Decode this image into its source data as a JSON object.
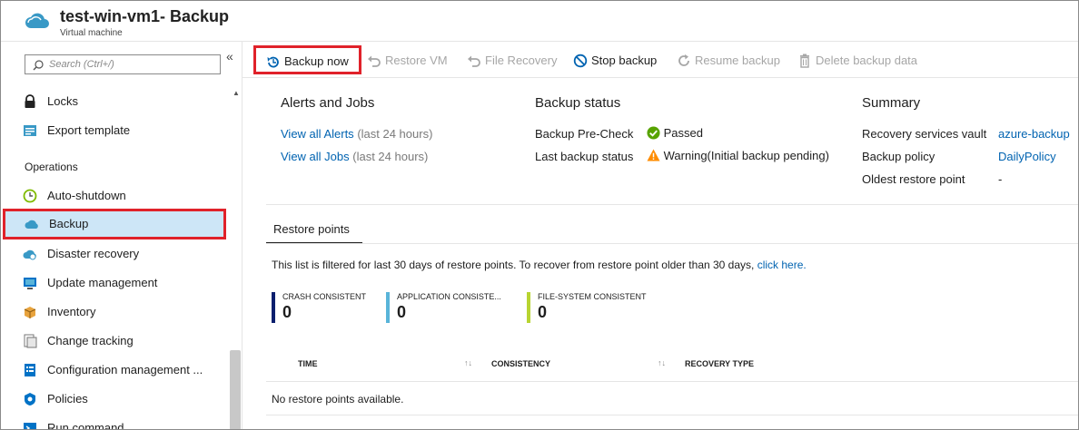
{
  "header": {
    "title": "test-win-vm1- Backup",
    "subtitle": "Virtual machine"
  },
  "sidebar": {
    "search_placeholder": "Search (Ctrl+/)",
    "collapse_glyph": "«",
    "items": [
      {
        "label": "Locks",
        "icon": "lock-icon"
      },
      {
        "label": "Export template",
        "icon": "export-template-icon"
      },
      {
        "label": "Auto-shutdown",
        "icon": "clock-icon"
      },
      {
        "label": "Backup",
        "icon": "backup-cloud-icon",
        "active": true
      },
      {
        "label": "Disaster recovery",
        "icon": "disaster-recovery-icon"
      },
      {
        "label": "Update management",
        "icon": "update-management-icon"
      },
      {
        "label": "Inventory",
        "icon": "inventory-icon"
      },
      {
        "label": "Change tracking",
        "icon": "change-tracking-icon"
      },
      {
        "label": "Configuration management ...",
        "icon": "configuration-icon"
      },
      {
        "label": "Policies",
        "icon": "policies-icon"
      },
      {
        "label": "Run command",
        "icon": "run-command-icon"
      }
    ],
    "section_operations": "Operations"
  },
  "toolbar": {
    "backup_now": "Backup now",
    "restore_vm": "Restore VM",
    "file_recovery": "File Recovery",
    "stop_backup": "Stop backup",
    "resume_backup": "Resume backup",
    "delete_backup_data": "Delete backup data"
  },
  "alerts_jobs": {
    "heading": "Alerts and Jobs",
    "view_alerts": "View all Alerts",
    "view_alerts_suffix": "(last 24 hours)",
    "view_jobs": "View all Jobs",
    "view_jobs_suffix": "(last 24 hours)"
  },
  "backup_status": {
    "heading": "Backup status",
    "precheck_label": "Backup Pre-Check",
    "precheck_value": "Passed",
    "last_backup_label": "Last backup status",
    "last_backup_value": "Warning(Initial backup pending)"
  },
  "summary": {
    "heading": "Summary",
    "vault_label": "Recovery services vault",
    "vault_value": "azure-backup",
    "policy_label": "Backup policy",
    "policy_value": "DailyPolicy",
    "oldest_label": "Oldest restore point",
    "oldest_value": "-"
  },
  "restore_points": {
    "tab_label": "Restore points",
    "filter_note": "This list is filtered for last 30 days of restore points. To recover from restore point older than 30 days,",
    "filter_link": "click here.",
    "counters": [
      {
        "label": "CRASH CONSISTENT",
        "value": "0",
        "color": "#0b1f6e"
      },
      {
        "label": "APPLICATION CONSISTE...",
        "value": "0",
        "color": "#59b4d9"
      },
      {
        "label": "FILE-SYSTEM CONSISTENT",
        "value": "0",
        "color": "#b8d432"
      }
    ],
    "columns": [
      "TIME",
      "CONSISTENCY",
      "RECOVERY TYPE"
    ],
    "empty_message": "No restore points available."
  },
  "colors": {
    "link": "#0063b1",
    "highlight_border": "#e0222a",
    "active_bg": "#cde6f7",
    "success": "#57a300",
    "warning": "#ff8c00"
  }
}
